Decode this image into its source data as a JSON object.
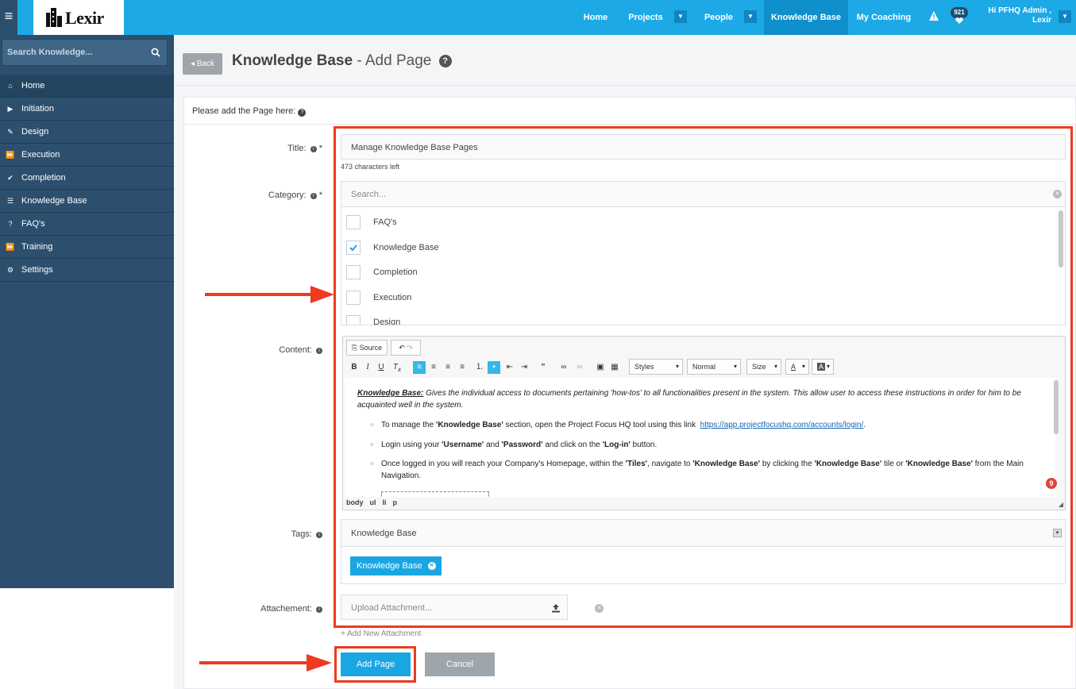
{
  "app": {
    "logo_text": "Lexir",
    "menu_icon": "hamburger-icon"
  },
  "nav": {
    "items": [
      {
        "label": "Home"
      },
      {
        "label": "Projects"
      },
      {
        "label": "People"
      },
      {
        "label": "Knowledge Base"
      },
      {
        "label": "My Coaching"
      }
    ],
    "notification_count": "921",
    "user_line1": "Hi PFHQ Admin ,",
    "user_line2": "Lexir"
  },
  "sidebar": {
    "search_placeholder": "Search Knowledge...",
    "items": [
      {
        "label": "Home",
        "icon": "home-icon"
      },
      {
        "label": "Initiation",
        "icon": "play-icon"
      },
      {
        "label": "Design",
        "icon": "brush-icon"
      },
      {
        "label": "Execution",
        "icon": "fast-forward-icon"
      },
      {
        "label": "Completion",
        "icon": "check-circle-icon"
      },
      {
        "label": "Knowledge Base",
        "icon": "sliders-icon"
      },
      {
        "label": "FAQ's",
        "icon": "question-icon"
      },
      {
        "label": "Training",
        "icon": "fast-forward-icon"
      },
      {
        "label": "Settings",
        "icon": "gears-icon"
      }
    ]
  },
  "page": {
    "back_label": "Back",
    "title": "Knowledge Base",
    "subtitle": "- Add Page",
    "intro": "Please add the Page here:"
  },
  "form": {
    "title_label": "Title:",
    "title_value": "Manage Knowledge Base Pages",
    "chars_left": "473 characters left",
    "category_label": "Category:",
    "category_search_placeholder": "Search...",
    "categories": [
      {
        "label": "FAQ's",
        "checked": false
      },
      {
        "label": "Knowledge Base",
        "checked": true
      },
      {
        "label": "Completion",
        "checked": false
      },
      {
        "label": "Execution",
        "checked": false
      },
      {
        "label": "Design",
        "checked": false
      }
    ],
    "content_label": "Content:",
    "editor": {
      "source_label": "Source",
      "styles_label": "Styles",
      "format_label": "Normal",
      "size_label": "Size",
      "p1_bold": "Knowledge Base:",
      "p1_text": " Gives the individual access to documents pertaining 'how-tos' to all functionalities present in the system. This allow user to access these instructions in order for him to be acquainted well in the system.",
      "li1_a": "To manage the ",
      "li1_b": "'Knowledge Base'",
      "li1_c": " section, open the Project Focus HQ tool using this ",
      "li1_d": "link",
      "li1_url": "https://app.projectfocushq.com/accounts/login/",
      "li2_a": "Login using your ",
      "li2_b": "'Username'",
      "li2_c": " and ",
      "li2_d": "'Password'",
      "li2_e": " and click on the ",
      "li2_f": "'Log-in'",
      "li2_g": " button.",
      "li3_a": "Once logged in you will reach your Company's Homepage, within the ",
      "li3_b": "'Tiles'",
      "li3_c": ", navigate to ",
      "li3_d": "'Knowledge Base'",
      "li3_e": " by clicking the ",
      "li3_f": "'Knowledge Base'",
      "li3_g": " tile or ",
      "li3_h": "'Knowledge Base'",
      "li3_i": " from the Main Navigation.",
      "path": [
        "body",
        "ul",
        "li",
        "p"
      ],
      "badge": "9"
    },
    "tags_label": "Tags:",
    "tags_value": "Knowledge Base",
    "tag_chip": "Knowledge Base",
    "attachment_label": "Attachement:",
    "attachment_placeholder": "Upload Attachment...",
    "add_attachment": "Add New Attachment",
    "submit_label": "Add Page",
    "cancel_label": "Cancel"
  },
  "colors": {
    "accent": "#1ca9e6",
    "sidebar": "#2c4f6e",
    "annotation": "#ee3a1e"
  }
}
